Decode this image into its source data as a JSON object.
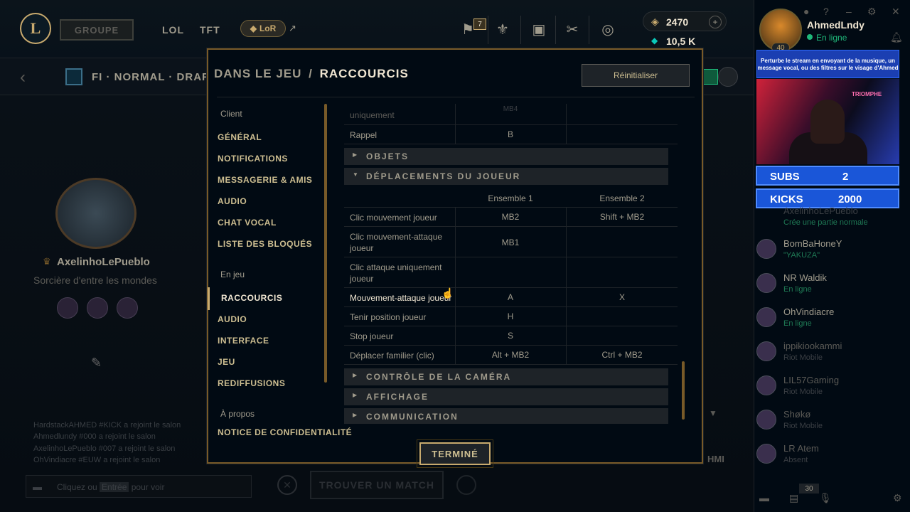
{
  "topbar": {
    "groupe_label": "GROUPE",
    "tabs": [
      "LOL",
      "TFT"
    ],
    "lor_label": "LoR",
    "lor_arrow": "↗",
    "badge_count": "7",
    "rp_value": "2470",
    "be_value": "10,5 K",
    "plus": "+"
  },
  "profile": {
    "name": "AhmedLndy",
    "status": "En ligne",
    "level": "40"
  },
  "lobby": {
    "title": "FI · NORMAL · DRAFT",
    "summoner_name": "AxelinhoLePueblo",
    "summoner_title": "Sorcière d'entre les mondes",
    "chat_log": [
      "HardstackAHMED #KICK a rejoint le salon",
      "Ahmedlundy #000 a rejoint le salon",
      "AxelinhoLePueblo #007 a rejoint le salon",
      "OhVindiacre #EUW a rejoint le salon"
    ],
    "chat_placeholder_pre": "Cliquez ou",
    "chat_placeholder_key": "Entrée",
    "chat_placeholder_post": "pour voir",
    "find_match": "TROUVER UN MATCH",
    "right_small": "HMI"
  },
  "overlay": {
    "banner": "Perturbe le stream en envoyant de la musique, un message vocal, ou des filtres sur le visage d'Ahmed",
    "cam_sign": "TRIOMPHE",
    "subs_label": "SUBS",
    "subs_value": "2",
    "kicks_label": "KICKS",
    "kicks_value": "2000"
  },
  "friends": [
    {
      "name": "AxelinhoLePueblo",
      "status": "Crée une partie normale",
      "dim": false
    },
    {
      "name": "BomBaHoneY",
      "status": "\"YAKUZA\"",
      "dim": false
    },
    {
      "name": "NR Waldik",
      "status": "En ligne",
      "dim": false
    },
    {
      "name": "OhVindiacre",
      "status": "En ligne",
      "dim": false
    },
    {
      "name": "ippikiookammi",
      "status": "Riot Mobile",
      "dim": true
    },
    {
      "name": "LIL57Gaming",
      "status": "Riot Mobile",
      "dim": true
    },
    {
      "name": "Shøkø",
      "status": "Riot Mobile",
      "dim": true
    },
    {
      "name": "LR Atem",
      "status": "Absent",
      "dim": true
    }
  ],
  "bottom": {
    "count": "30"
  },
  "modal": {
    "crumb_1": "DANS LE JEU",
    "crumb_sep": "/",
    "crumb_2": "RACCOURCIS",
    "reset": "Réinitialiser",
    "done": "TERMINÉ",
    "nav": {
      "cat_client": "Client",
      "cat_game": "En jeu",
      "cat_about": "À propos",
      "client_items": [
        "GÉNÉRAL",
        "NOTIFICATIONS",
        "MESSAGERIE & AMIS",
        "AUDIO",
        "CHAT VOCAL",
        "LISTE DES BLOQUÉS"
      ],
      "game_items": [
        "RACCOURCIS",
        "AUDIO",
        "INTERFACE",
        "JEU",
        "REDIFFUSIONS"
      ],
      "about_items": [
        "NOTICE DE CONFIDENTIALITÉ"
      ]
    },
    "partial_row": {
      "label": "uniquement",
      "v1": "MB4"
    },
    "rappel_row": {
      "label": "Rappel",
      "v1": "B",
      "v2": ""
    },
    "sections": {
      "objets": "OBJETS",
      "deplacements": "DÉPLACEMENTS DU JOUEUR",
      "camera": "CONTRÔLE DE LA CAMÉRA",
      "affichage": "AFFICHAGE",
      "communication": "COMMUNICATION"
    },
    "col1": "Ensemble 1",
    "col2": "Ensemble 2",
    "rows": [
      {
        "label": "Clic mouvement joueur",
        "v1": "MB2",
        "v2": "Shift + MB2"
      },
      {
        "label": "Clic mouvement-attaque joueur",
        "v1": "MB1",
        "v2": ""
      },
      {
        "label": "Clic attaque uniquement joueur",
        "v1": "",
        "v2": ""
      },
      {
        "label": "Mouvement-attaque joueur",
        "v1": "A",
        "v2": "X"
      },
      {
        "label": "Tenir position joueur",
        "v1": "H",
        "v2": ""
      },
      {
        "label": "Stop joueur",
        "v1": "S",
        "v2": ""
      },
      {
        "label": "Déplacer familier (clic)",
        "v1": "Alt + MB2",
        "v2": "Ctrl + MB2"
      }
    ]
  }
}
